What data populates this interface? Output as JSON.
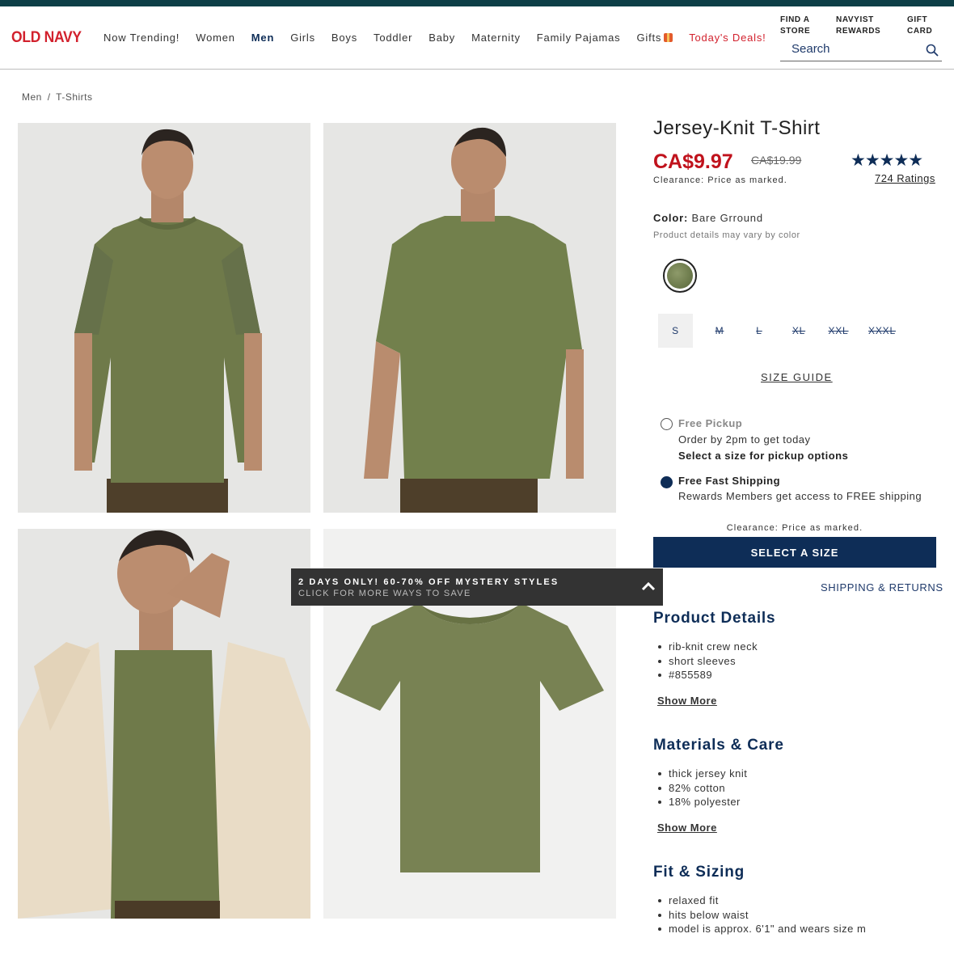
{
  "header": {
    "logo": "OLD NAVY",
    "nav": [
      "Now Trending!",
      "Women",
      "Men",
      "Girls",
      "Boys",
      "Toddler",
      "Baby",
      "Maternity",
      "Family Pajamas",
      "Gifts",
      "Today's Deals!"
    ],
    "active_nav": "Men",
    "utility": {
      "find_store": "FIND A\nSTORE",
      "navyist_rewards": "NAVYIST\nREWARDS",
      "gift_card": "GIFT\nCARD"
    },
    "search_placeholder": "Search"
  },
  "breadcrumb": {
    "items": [
      "Men",
      "T-Shirts"
    ],
    "separator": "/"
  },
  "promo": {
    "title": "2 DAYS ONLY! 60-70% OFF MYSTERY STYLES",
    "subtitle": "CLICK FOR MORE WAYS TO SAVE"
  },
  "product": {
    "title": "Jersey-Knit T-Shirt",
    "price": "CA$9.97",
    "original_price": "CA$19.99",
    "clearance_note": "Clearance: Price as marked.",
    "stars": "★★★★★",
    "rating_value": 4.8,
    "ratings_link": "724 Ratings",
    "color_label": "Color:",
    "color_name": "Bare Grround",
    "color_note": "Product details may vary by color",
    "sizes": [
      {
        "label": "S",
        "available": true,
        "selected": true
      },
      {
        "label": "M",
        "available": false
      },
      {
        "label": "L",
        "available": false
      },
      {
        "label": "XL",
        "available": false
      },
      {
        "label": "XXL",
        "available": false
      },
      {
        "label": "XXXL",
        "available": false
      }
    ],
    "size_guide": "SIZE GUIDE"
  },
  "fulfillment": {
    "pickup_title": "Free Pickup",
    "pickup_line1": "Order by 2pm to get today",
    "pickup_line2": "Select a size for pickup options",
    "shipping_title": "Free Fast Shipping",
    "shipping_line1": "Rewards Members get access to FREE shipping"
  },
  "cta": {
    "clearance_note": "Clearance: Price as marked.",
    "select_size": "SELECT A SIZE",
    "shipping_returns": "SHIPPING & RETURNS"
  },
  "details": {
    "product_details_title": "Product Details",
    "product_details": [
      "rib-knit crew neck",
      "short sleeves",
      "#855589"
    ],
    "materials_title": "Materials & Care",
    "materials": [
      "thick jersey knit",
      "82% cotton",
      "18% polyester"
    ],
    "fit_title": "Fit & Sizing",
    "fit": [
      "relaxed fit",
      "hits below waist",
      "model is approx. 6'1\" and wears size m"
    ],
    "show_more": "Show More"
  },
  "colors": {
    "brand_red": "#d2212d",
    "navy": "#0e2d57",
    "sale_red": "#c0121c",
    "shirt_green": "#75804f"
  }
}
